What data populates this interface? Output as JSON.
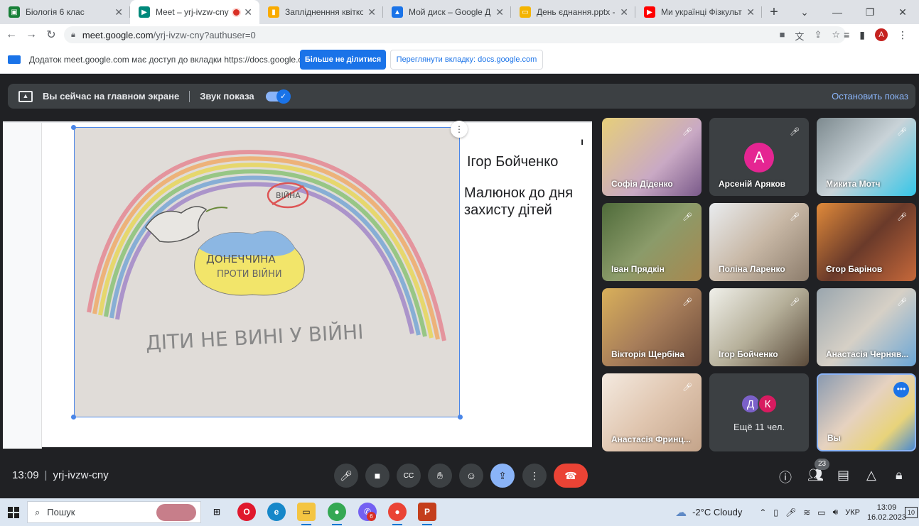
{
  "browser": {
    "tabs": [
      {
        "title": "Біологія 6 клас",
        "color": "#188038"
      },
      {
        "title": "Meet – yrj-ivzw-cny",
        "color": "#00897b"
      },
      {
        "title": "Заплідненння квіткових рос",
        "color": "#f9ab00"
      },
      {
        "title": "Мой диск – Google Диск",
        "color": "#1a73e8"
      },
      {
        "title": "День єднання.pptx - G",
        "color": "#f4b400"
      },
      {
        "title": "Ми українці Фізкультхвил",
        "color": "#ff0000"
      }
    ],
    "url_domain": "meet.google.com",
    "url_path": "/yrj-ivzw-cny?authuser=0",
    "profile_letter": "A"
  },
  "infobar": {
    "message": "Додаток meet.google.com має доступ до вкладки https://docs.google.com",
    "stop_sharing": "Більше не ділитися",
    "view_tab": "Переглянути вкладку: docs.google.com"
  },
  "present": {
    "status": "Вы сейчас на главном экране",
    "sound_label": "Звук показа",
    "stop_label": "Остановить показ"
  },
  "slide": {
    "name": "Ігор Бойченко",
    "caption": "Малюнок до дня захисту дітей",
    "drawing_words": [
      "ВІЙНА",
      "ДОНЕЧЧИНА",
      "ПРОТИ ВІЙНИ",
      "ДІТИ НЕ ВИНІ У ВІЙНІ"
    ]
  },
  "participants": [
    {
      "name": "Софія Діденко"
    },
    {
      "name": "Арсеній Аряков",
      "letter": "А"
    },
    {
      "name": "Микита Мотч"
    },
    {
      "name": "Іван Прядкін"
    },
    {
      "name": "Поліна Ларенко"
    },
    {
      "name": "Єгор Барінов"
    },
    {
      "name": "Вікторія Щербіна"
    },
    {
      "name": "Ігор Бойченко"
    },
    {
      "name": "Анастасія Черняв..."
    },
    {
      "name": "Анастасія Фринц..."
    },
    {
      "name": "Ещё 11 чел.",
      "letters": [
        "Д",
        "К"
      ]
    },
    {
      "name": "Вы"
    }
  ],
  "meeting": {
    "time": "13:09",
    "code": "yrj-ivzw-cny",
    "participant_count": "23"
  },
  "taskbar": {
    "search": "Пошук",
    "weather": "-2°C  Cloudy",
    "lang": "УКР",
    "time": "13:09",
    "date": "16.02.2023",
    "notifications": "10",
    "viber_badge": "6"
  }
}
